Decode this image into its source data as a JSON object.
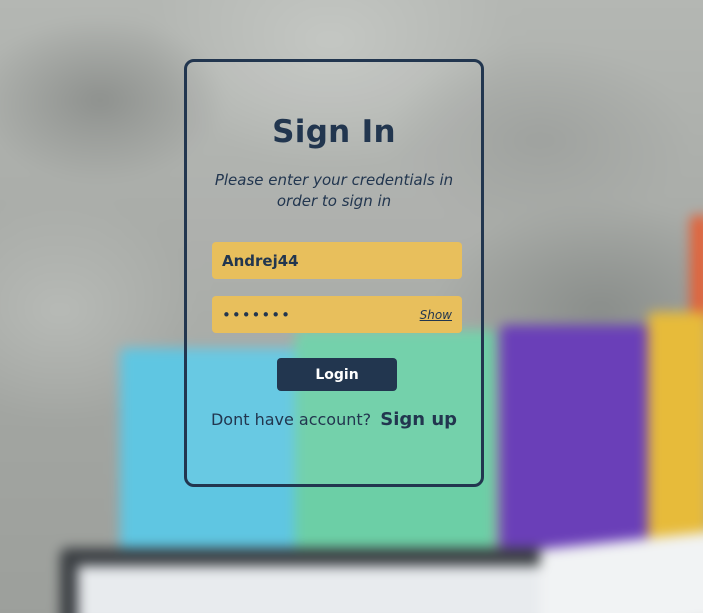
{
  "login": {
    "title": "Sign In",
    "subtitle": "Please enter your credentials in order to sign in",
    "username": {
      "value": "Andrej44"
    },
    "password": {
      "masked_value": "•••••••",
      "show_label": "Show"
    },
    "login_button": "Login",
    "signup_prompt": "Dont have account?",
    "signup_link": "Sign up"
  },
  "colors": {
    "primary_navy": "#22364f",
    "input_yellow": "#e8bf5c",
    "button_text": "#ffffff"
  },
  "icons": []
}
